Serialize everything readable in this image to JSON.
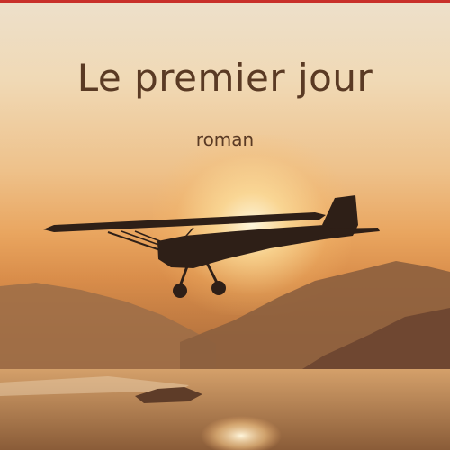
{
  "cover": {
    "title": "Le premier jour",
    "subtitle": "roman"
  },
  "colors": {
    "sky_top": "#ede0cb",
    "sun": "#fff3d6",
    "text": "#5a3a24",
    "accent_line": "#c8302a",
    "silhouette": "#2e1f17"
  },
  "elements": {
    "plane": "airplane-silhouette",
    "mountains": "mountain-range",
    "lake": "lake-reflection",
    "sun": "sun-glow"
  }
}
